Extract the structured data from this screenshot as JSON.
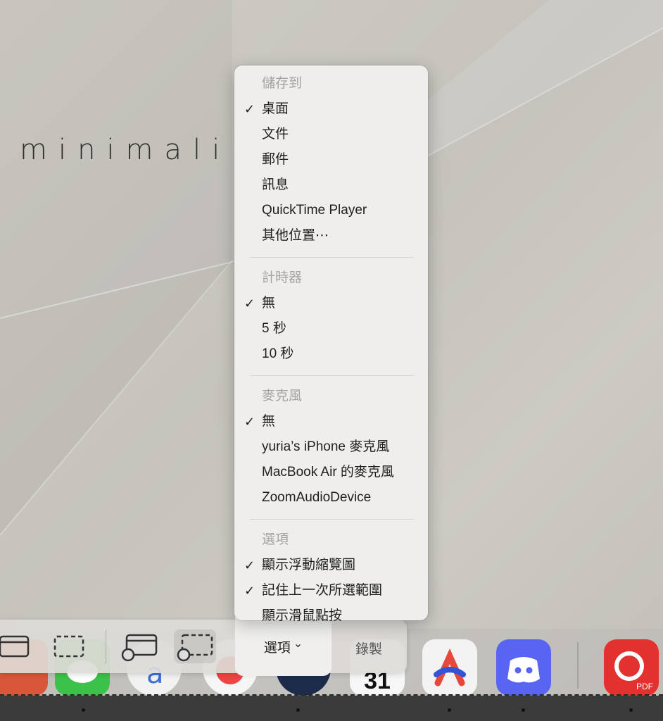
{
  "wallpaper": {
    "text": "minimali"
  },
  "menu": {
    "sections": [
      {
        "header": "儲存到",
        "items": [
          {
            "label": "桌面",
            "checked": true
          },
          {
            "label": "文件",
            "checked": false
          },
          {
            "label": "郵件",
            "checked": false
          },
          {
            "label": "訊息",
            "checked": false
          },
          {
            "label": "QuickTime Player",
            "checked": false
          },
          {
            "label": "其他位置⋯",
            "checked": false
          }
        ]
      },
      {
        "header": "計時器",
        "items": [
          {
            "label": "無",
            "checked": true
          },
          {
            "label": "5 秒",
            "checked": false
          },
          {
            "label": "10 秒",
            "checked": false
          }
        ]
      },
      {
        "header": "麥克風",
        "items": [
          {
            "label": "無",
            "checked": true
          },
          {
            "label": "yuria’s iPhone 麥克風",
            "checked": false
          },
          {
            "label": "MacBook Air 的麥克風",
            "checked": false
          },
          {
            "label": "ZoomAudioDevice",
            "checked": false
          }
        ]
      },
      {
        "header": "選項",
        "items": [
          {
            "label": "顯示浮動縮覽圖",
            "checked": true
          },
          {
            "label": "記住上一次所選範圍",
            "checked": true
          },
          {
            "label": "顯示滑鼠點按",
            "checked": false
          }
        ]
      }
    ],
    "checkmark": "✓"
  },
  "toolbar": {
    "options_label": "選項",
    "options_chevron": "⌄",
    "record_label": "錄製"
  },
  "dock": {
    "pdf_badge": "PDF",
    "calendar_day": "31"
  }
}
